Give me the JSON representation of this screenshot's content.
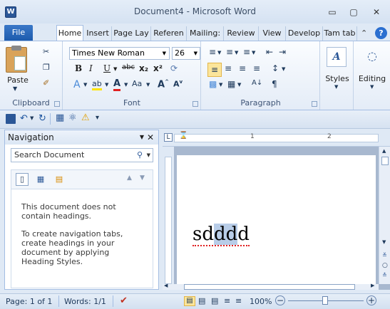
{
  "window": {
    "title": "Document4 - Microsoft Word",
    "logo": "W"
  },
  "tabs": [
    {
      "label": "File"
    },
    {
      "label": "Home"
    },
    {
      "label": "Insert"
    },
    {
      "label": "Page Lay"
    },
    {
      "label": "Referen"
    },
    {
      "label": "Mailing:"
    },
    {
      "label": "Review"
    },
    {
      "label": "View"
    },
    {
      "label": "Develop"
    },
    {
      "label": "Tam tab"
    }
  ],
  "ribbon": {
    "clipboard": {
      "paste_label": "Paste",
      "group_label": "Clipboard"
    },
    "font": {
      "font_name": "Times New Roman",
      "font_size": "26",
      "group_label": "Font",
      "bold": "B",
      "italic": "I",
      "underline": "U",
      "grow": "A",
      "shrink": "A",
      "case": "Aa"
    },
    "paragraph": {
      "group_label": "Paragraph"
    },
    "styles": {
      "label": "Styles"
    },
    "editing": {
      "label": "Editing"
    }
  },
  "navigation": {
    "title": "Navigation",
    "search_placeholder": "Search Document",
    "message1": "This document does not contain headings.",
    "message2": "To create navigation tabs, create headings in your document by applying Heading Styles."
  },
  "document": {
    "text_normal": "s",
    "text_d1": "d",
    "text_selected": "dd",
    "text_d4": "d"
  },
  "ruler": {
    "marks": [
      "1",
      "2"
    ]
  },
  "status": {
    "page": "Page: 1 of 1",
    "words": "Words: 1/1",
    "zoom": "100%"
  },
  "colors": {
    "accent": "#2b5797",
    "file_tab": "#2a6ab8",
    "selection": "#b8cde8"
  }
}
